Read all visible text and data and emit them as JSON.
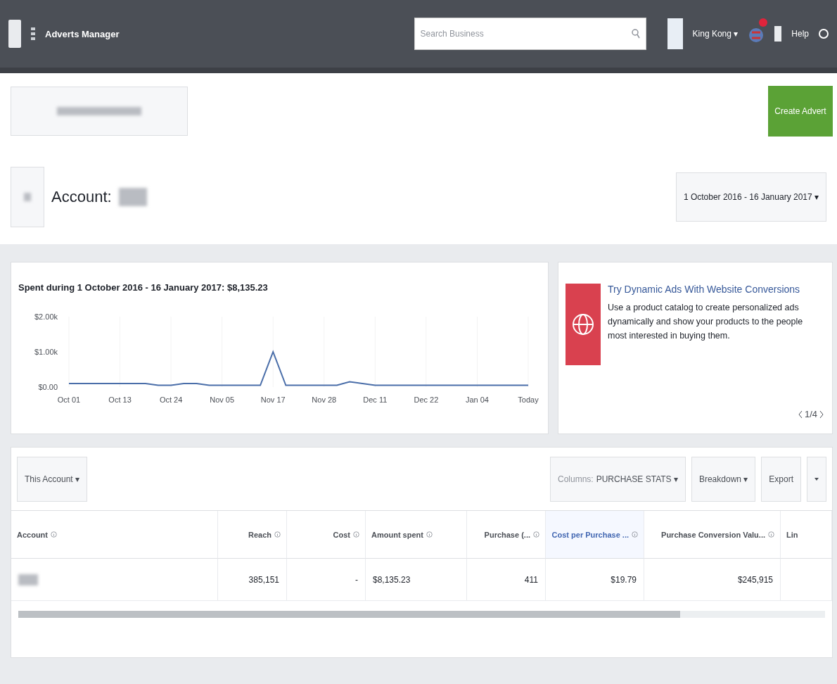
{
  "topbar": {
    "app_name": "Adverts Manager",
    "search": {
      "placeholder": "Search Business"
    },
    "user": "King Kong ▾",
    "help": "Help"
  },
  "header": {
    "create_button": "Create Advert"
  },
  "breadcrumb": {
    "label": "Account:",
    "date_range": "1 October 2016 - 16 January 2017 ▾"
  },
  "spend_chart": {
    "chart_data": {
      "type": "line",
      "title": "Spent during 1 October 2016 - 16 January 2017: $8,135.23",
      "categories": [
        "Oct 01",
        null,
        null,
        null,
        "Oct 13",
        null,
        null,
        null,
        "Oct 24",
        null,
        null,
        null,
        "Nov 05",
        null,
        null,
        null,
        "Nov 17",
        null,
        null,
        null,
        "Nov 28",
        null,
        null,
        null,
        "Dec 11",
        null,
        null,
        null,
        "Dec 22",
        null,
        null,
        null,
        "Jan 04",
        null,
        null,
        null,
        "Today"
      ],
      "series": [
        {
          "color": "#4a6ea9",
          "values": [
            100,
            100,
            100,
            100,
            100,
            100,
            100,
            50,
            50,
            100,
            100,
            50,
            50,
            50,
            50,
            50,
            1000,
            50,
            50,
            50,
            50,
            50,
            150,
            100,
            50,
            50,
            50,
            50,
            50,
            50,
            50,
            50,
            50,
            50,
            50,
            50,
            50
          ]
        }
      ],
      "grid": true,
      "ylim": [
        0,
        2000
      ],
      "yticks": [
        {
          "value": 0,
          "label": "$0.00"
        },
        {
          "value": 1000,
          "label": "$1.00k"
        },
        {
          "value": 2000,
          "label": "$2.00k"
        }
      ]
    }
  },
  "promo": {
    "title": "Try Dynamic Ads With Website Conversions",
    "body": "Use a product catalog to create personalized ads dynamically and show your products to the people most interested in buying them.",
    "pager": "1/4"
  },
  "toolbar": {
    "scope": "This Account ▾",
    "columns_prefix": "Columns:",
    "columns_value": "PURCHASE STATS ▾",
    "breakdown": "Breakdown ▾",
    "export": "Export"
  },
  "table": {
    "columns": [
      {
        "label": "Account",
        "kind": "text",
        "selected": false
      },
      {
        "label": "Reach",
        "kind": "number",
        "selected": false
      },
      {
        "label": "Cost",
        "kind": "number",
        "selected": false
      },
      {
        "label": "Amount spent",
        "kind": "text",
        "selected": false
      },
      {
        "label": "Purchase (...",
        "kind": "number",
        "selected": false
      },
      {
        "label": "Cost per Purchase ...",
        "kind": "number",
        "selected": true
      },
      {
        "label": "Purchase Conversion Valu...",
        "kind": "number",
        "selected": false
      },
      {
        "label": "Lin",
        "kind": "text",
        "selected": false
      }
    ],
    "rows": [
      {
        "cells": [
          "",
          "385,151",
          "-",
          "$8,135.23",
          "411",
          "$19.79",
          "$245,915",
          ""
        ]
      }
    ]
  }
}
